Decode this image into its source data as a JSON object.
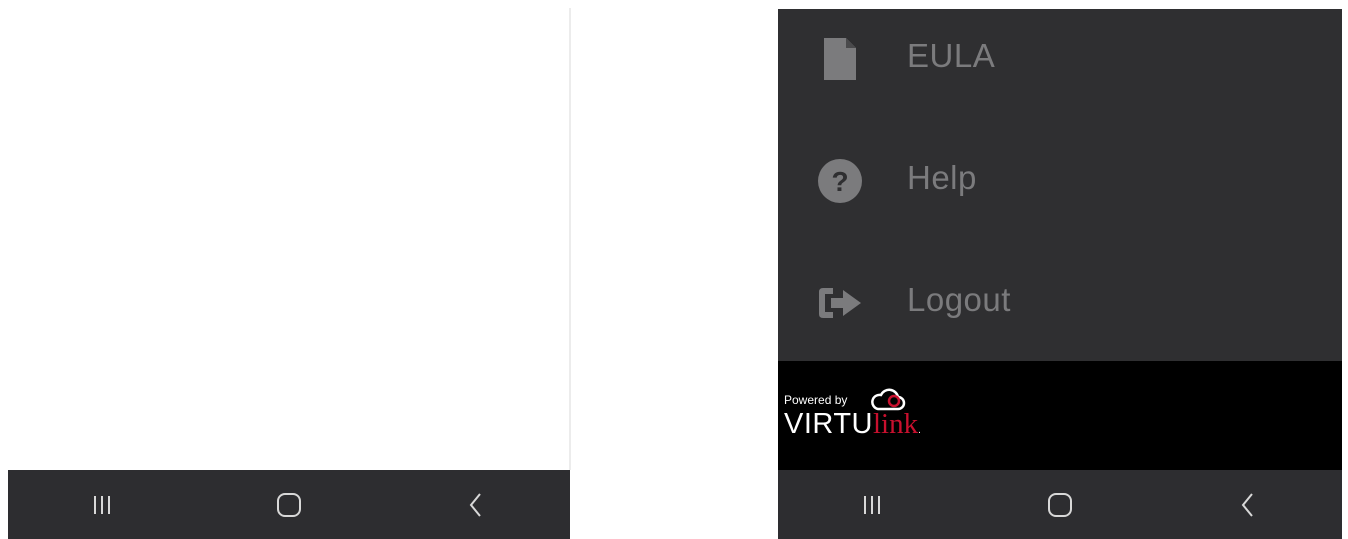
{
  "left_panel": {
    "navbar": {
      "recents_icon": "recents-icon",
      "home_icon": "home-icon",
      "back_icon": "back-icon"
    }
  },
  "right_panel": {
    "menu": [
      {
        "label": "EULA",
        "icon": "document-icon"
      },
      {
        "label": "Help",
        "icon": "help-circle-icon"
      },
      {
        "label": "Logout",
        "icon": "logout-icon"
      }
    ],
    "footer": {
      "powered_by": "Powered by",
      "brand_primary": "VIRTU",
      "brand_secondary": "link",
      "brand_mark": "."
    },
    "navbar": {
      "recents_icon": "recents-icon",
      "home_icon": "home-icon",
      "back_icon": "back-icon"
    }
  },
  "colors": {
    "drawer_bg": "#2f2f31",
    "navbar_bg": "#2d2d30",
    "menu_text": "#7b7b7d",
    "footer_bg": "#000000",
    "brand_red": "#c8102e"
  }
}
